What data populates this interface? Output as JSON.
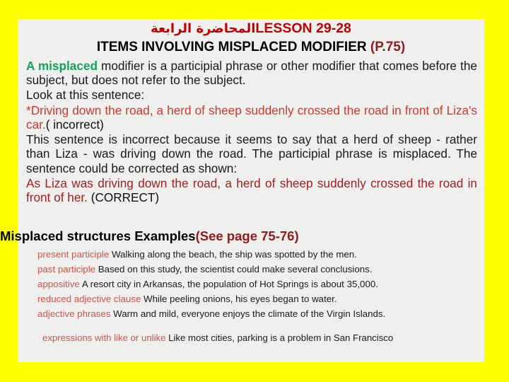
{
  "slide": {
    "background_color": "#ffff00",
    "content_background_color": "#efefed",
    "title_arabic": "المحاضرة الرابعة",
    "title_lesson": "LESSON 29-28",
    "subtitle_main": "ITEMS INVOLVING MISPLACED MODIFIER ",
    "subtitle_page_ref": "(P.75)",
    "definition": {
      "highlight": "A misplaced",
      "rest": " modifier is a participial phrase or other modifier that comes before the subject, but does not refer to the subject."
    },
    "look_at": "Look at this sentence:",
    "incorrect_example": {
      "sentence": "*Driving down the road, a herd of sheep suddenly crossed the road in front of Liza's car.",
      "tag": "( incorrect)"
    },
    "explanation": "This sentence is incorrect because it seems to say that a herd of sheep - rather than Liza - was driving down the road. The participial phrase is misplaced. The sentence could be corrected as shown:",
    "correct_example": {
      "sentence": " As Liza was driving down the road, a herd of sheep suddenly crossed the road in front of her.",
      "tag": " (CORRECT)"
    },
    "structures_header": {
      "main": "Misplaced structures Examples",
      "see_page": "(See page 75-76)"
    },
    "examples": [
      {
        "label": "present participle",
        "text": " Walking along the beach, the ship was spotted by the men."
      },
      {
        "label": "past participle",
        "text": " Based on this study, the scientist could make several conclusions."
      },
      {
        "label": "appositive",
        "text": "  A resort city in Arkansas, the population of Hot Springs is about 35,000."
      },
      {
        "label": "reduced adjective clause",
        "text": " While peeling onions, his eyes began to water."
      },
      {
        "label": "adjective phrases",
        "text": " Warm and mild, everyone enjoys the climate of the Virgin Islands."
      }
    ],
    "example_last": {
      "label": "expressions with like or unlike",
      "text": "  Like most cities, parking is a problem in   San Francisco"
    },
    "colors": {
      "title_red": "#c00000",
      "dark_red": "#8f1d1d",
      "bright_red": "#d0392b",
      "green": "#16a05c",
      "label_red": "#d1534a"
    }
  }
}
